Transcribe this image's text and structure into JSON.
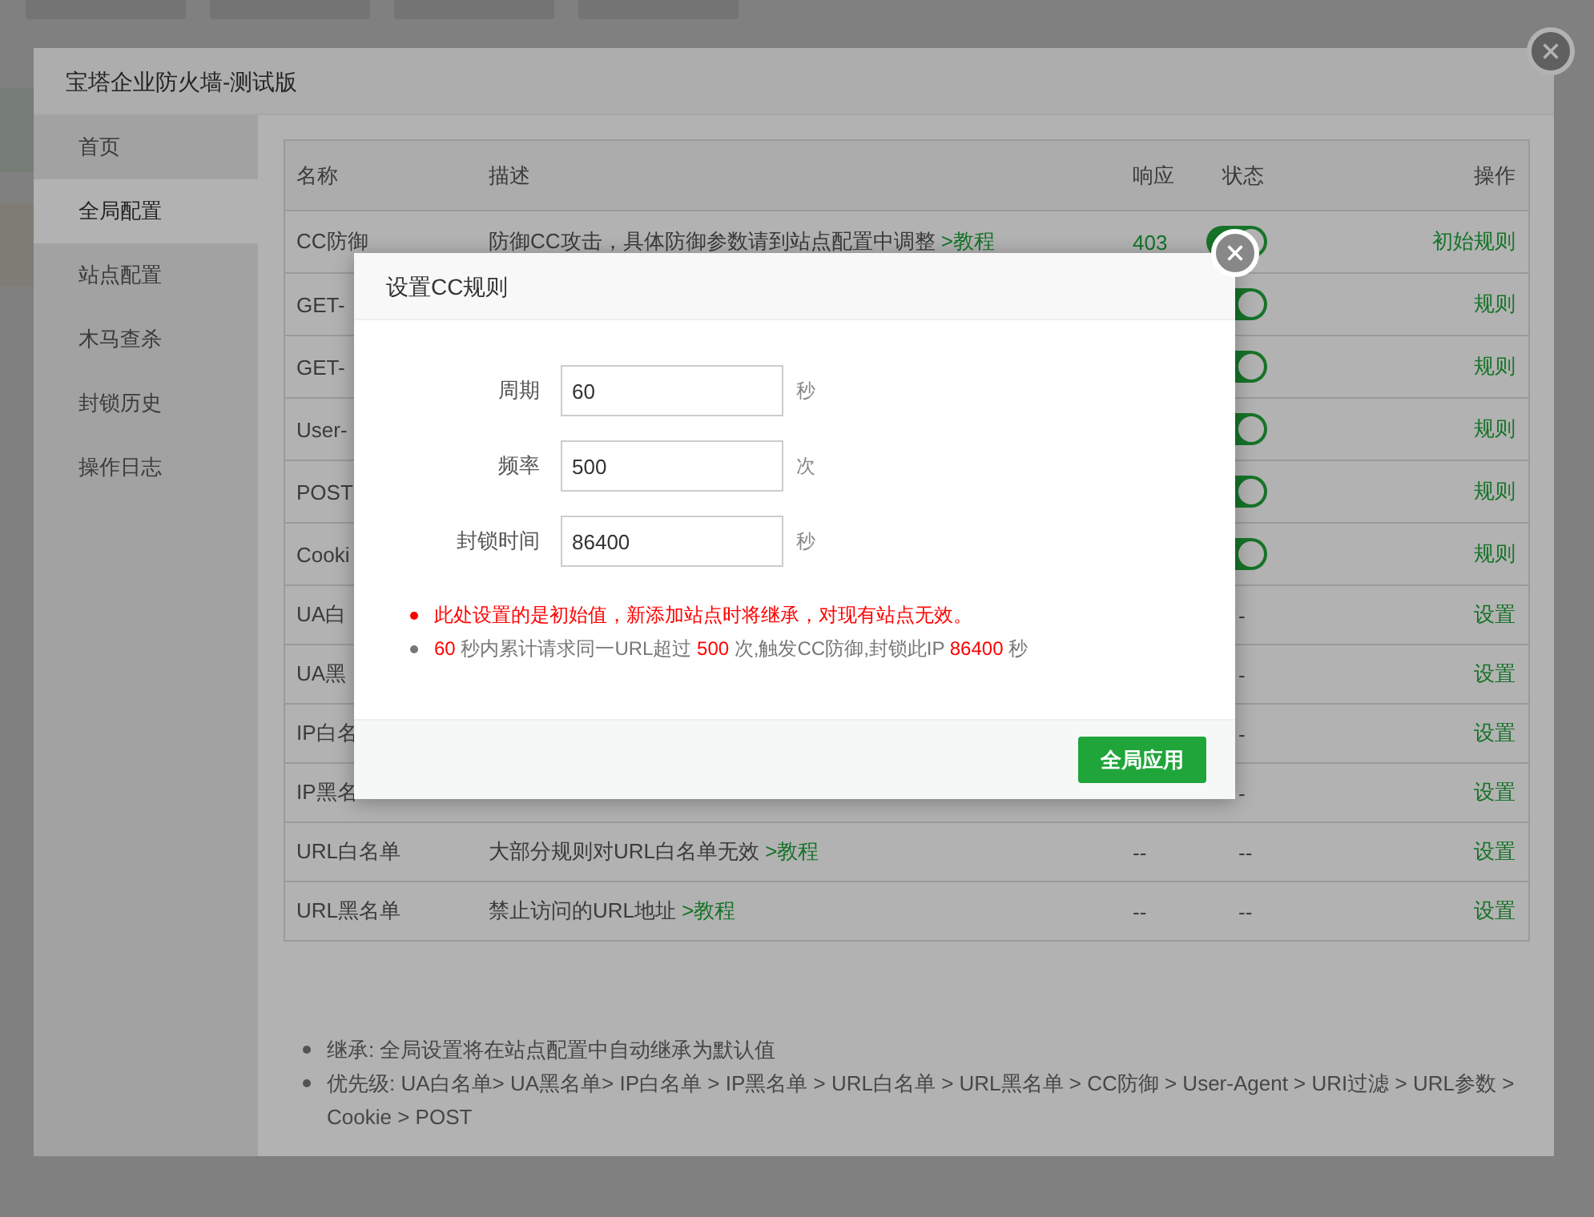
{
  "window": {
    "title": "宝塔企业防火墙-测试版"
  },
  "sidebar": {
    "items": [
      {
        "label": "首页",
        "selected": false
      },
      {
        "label": "全局配置",
        "selected": true
      },
      {
        "label": "站点配置",
        "selected": false
      },
      {
        "label": "木马查杀",
        "selected": false
      },
      {
        "label": "封锁历史",
        "selected": false
      },
      {
        "label": "操作日志",
        "selected": false
      }
    ]
  },
  "table": {
    "columns": [
      "名称",
      "描述",
      "响应",
      "状态",
      "操作"
    ],
    "rows": [
      {
        "name": "CC防御",
        "description": [
          {
            "text": "防御CC攻击，具体防御参数请到站点配置中调整 ",
            "link": false
          },
          {
            "text": ">教程",
            "link": true
          }
        ],
        "response": "403",
        "status": {
          "kind": "toggle",
          "on": true
        },
        "action": "初始规则"
      },
      {
        "name": "GET-",
        "status": {
          "kind": "toggle",
          "on": true
        },
        "action": "规则"
      },
      {
        "name": "GET-",
        "status": {
          "kind": "toggle",
          "on": true
        },
        "action": "规则"
      },
      {
        "name": "User-",
        "status": {
          "kind": "toggle",
          "on": true
        },
        "action": "规则"
      },
      {
        "name": "POST",
        "status": {
          "kind": "toggle",
          "on": true
        },
        "action": "规则"
      },
      {
        "name": "Cooki",
        "status": {
          "kind": "toggle",
          "on": true
        },
        "action": "规则"
      },
      {
        "name": "UA白",
        "status": {
          "kind": "text",
          "text": "-"
        },
        "action": "设置"
      },
      {
        "name": "UA黑",
        "status": {
          "kind": "text",
          "text": "-"
        },
        "action": "设置"
      },
      {
        "name": "IP白名",
        "status": {
          "kind": "text",
          "text": "-"
        },
        "action": "设置"
      },
      {
        "name": "IP黑名",
        "status": {
          "kind": "text",
          "text": "-"
        },
        "action": "设置"
      },
      {
        "name": "URL白名单",
        "description": [
          {
            "text": "大部分规则对URL白名单无效 ",
            "link": false
          },
          {
            "text": ">教程",
            "link": true
          }
        ],
        "response": "--",
        "status": {
          "kind": "text",
          "text": "--"
        },
        "action": "设置"
      },
      {
        "name": "URL黑名单",
        "description": [
          {
            "text": "禁止访问的URL地址 ",
            "link": false
          },
          {
            "text": ">教程",
            "link": true
          }
        ],
        "response": "--",
        "status": {
          "kind": "text",
          "text": "--"
        },
        "action": "设置"
      }
    ]
  },
  "notes": [
    "继承: 全局设置将在站点配置中自动继承为默认值",
    "优先级: UA白名单> UA黑名单> IP白名单 > IP黑名单 > URL白名单 > URL黑名单 > CC防御 > User-Agent > URI过滤 > URL参数 > Cookie > POST"
  ],
  "dialog": {
    "title": "设置CC规则",
    "fields": [
      {
        "label": "周期",
        "value": "60",
        "unit": "秒"
      },
      {
        "label": "频率",
        "value": "500",
        "unit": "次"
      },
      {
        "label": "封锁时间",
        "value": "86400",
        "unit": "秒"
      }
    ],
    "notes": [
      {
        "kind": "warning",
        "parts": [
          {
            "text": "此处设置的是初始值，新添加站点时将继承，对现有站点无效。"
          }
        ]
      },
      {
        "kind": "info",
        "parts": [
          {
            "text": "60",
            "highlight": true
          },
          {
            "text": " 秒内累计请求同一URL超过 ",
            "highlight": false
          },
          {
            "text": "500",
            "highlight": true
          },
          {
            "text": " 次,触发CC防御,封锁此IP ",
            "highlight": false
          },
          {
            "text": "86400",
            "highlight": true
          },
          {
            "text": " 秒",
            "highlight": false
          }
        ]
      }
    ],
    "button": "全局应用"
  }
}
